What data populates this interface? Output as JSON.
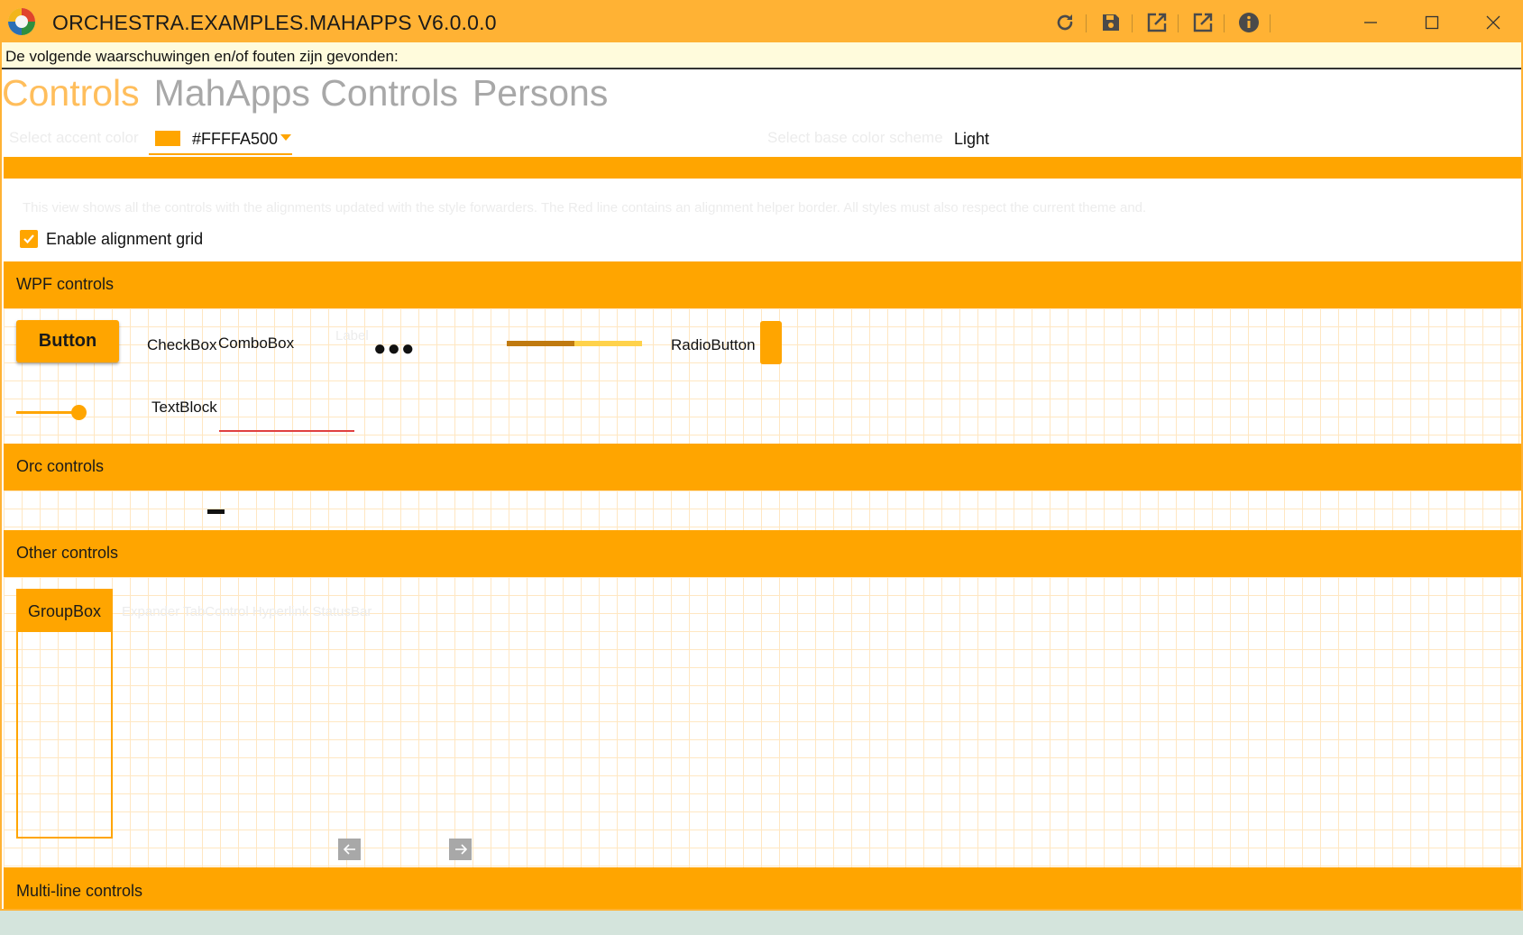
{
  "window": {
    "title": "ORCHESTRA.EXAMPLES.MAHAPPS V6.0.0.0",
    "titlebar_color": "#ffb234",
    "toolbar_icons": [
      "refresh-icon",
      "save-icon",
      "open-external-icon",
      "open-external-icon",
      "info-icon"
    ],
    "window_buttons": [
      "minimize-icon",
      "maximize-icon",
      "close-icon"
    ]
  },
  "warning": {
    "text": "De volgende waarschuwingen en/of fouten zijn gevonden:"
  },
  "tabs": [
    {
      "label": "Controls",
      "active": true
    },
    {
      "label": "MahApps Controls",
      "active": false
    },
    {
      "label": "Persons",
      "active": false
    }
  ],
  "accent": {
    "label": "Select accent color",
    "value": "#FFFFA500",
    "swatch_color": "#ffa500"
  },
  "theme": {
    "label": "Select base color scheme",
    "value": "Light"
  },
  "description": {
    "text": "This view shows all the controls with the alignments updated with the style forwarders. The Red line contains an alignment helper border. All styles must also respect the current theme and."
  },
  "alignment_grid": {
    "label": "Enable alignment grid",
    "checked": true
  },
  "sections": {
    "wpf": "WPF controls",
    "orc": "Orc controls",
    "other": "Other controls",
    "multiline": "Multi-line controls"
  },
  "wpf_controls": {
    "button_label": "Button",
    "checkbox_label": "CheckBox",
    "combobox_label": "ComboBox",
    "faint_label": "Label",
    "password_dots": "●●●",
    "progress_value": 0.5,
    "radio_label": "RadioButton",
    "slider_value": 0.9,
    "textblock_label": "TextBlock"
  },
  "other_controls": {
    "groupbox_label": "GroupBox",
    "faint_text": "Expander TabControl Hyperlink StatusBar"
  },
  "accent_color": "#ffa500"
}
